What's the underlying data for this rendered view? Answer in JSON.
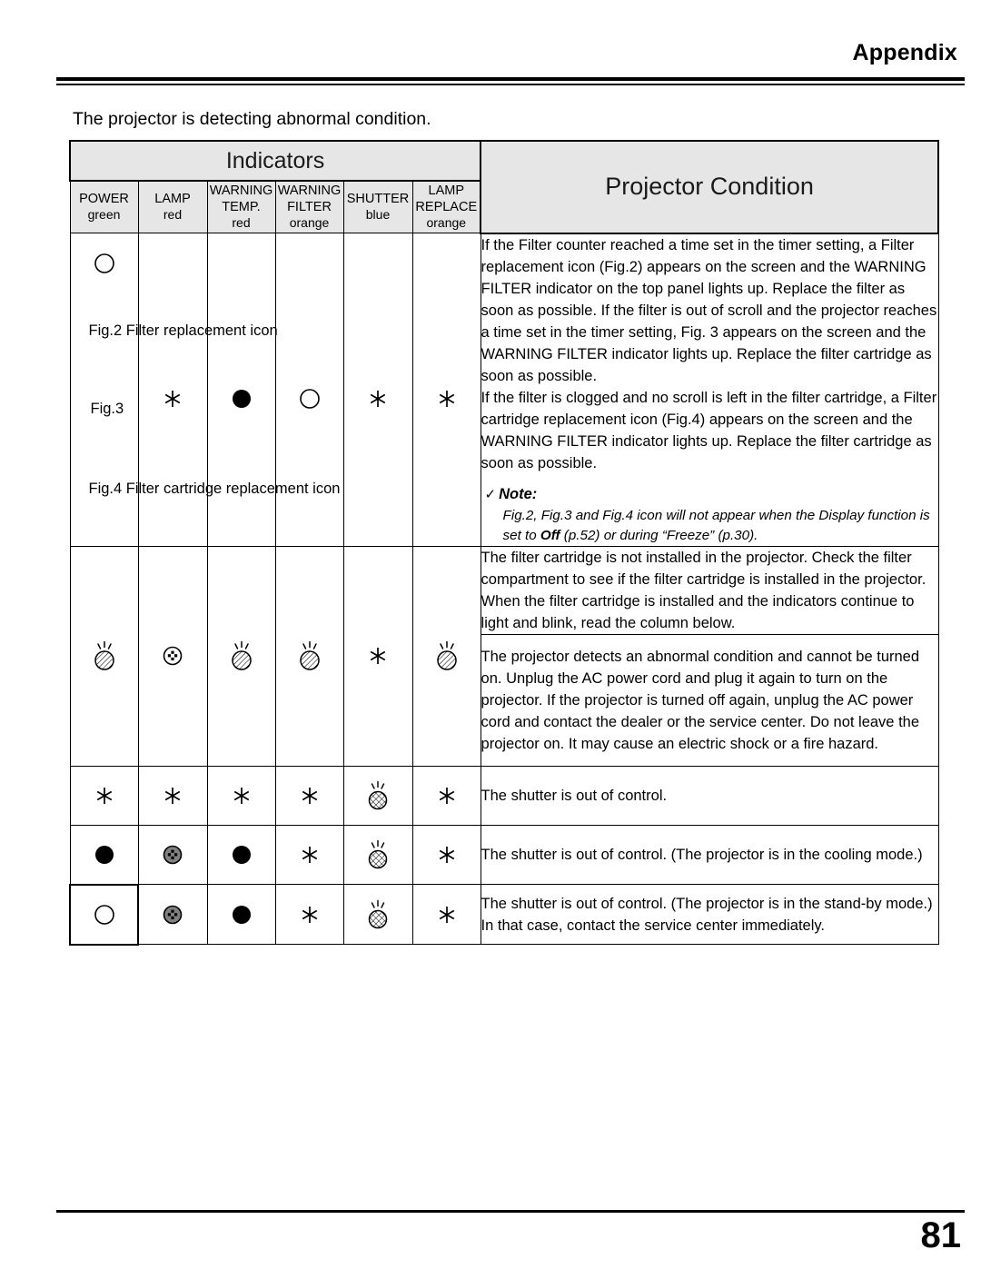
{
  "header": {
    "section_title": "Appendix"
  },
  "intro": {
    "text": "The projector is detecting abnormal condition."
  },
  "table": {
    "indicators_header": "Indicators",
    "condition_header": "Projector Condition",
    "columns": [
      {
        "name": "POWER",
        "color": "green"
      },
      {
        "name": "LAMP",
        "color": "red"
      },
      {
        "name": "WARNING TEMP.",
        "name_line1": "WARNING",
        "name_line2": "TEMP.",
        "color": "red"
      },
      {
        "name": "WARNING FILTER",
        "name_line1": "WARNING",
        "name_line2": "FILTER",
        "color": "orange"
      },
      {
        "name": "SHUTTER",
        "name_line1": "SHUTTER",
        "name_line2": "",
        "color": "blue"
      },
      {
        "name": "LAMP REPLACE",
        "name_line1": "LAMP",
        "name_line2": "REPLACE",
        "color": "orange"
      }
    ],
    "rows": [
      {
        "indicators": [
          "circle-open",
          "asterisk",
          "circle-filled",
          "circle-open",
          "asterisk",
          "asterisk"
        ],
        "figures": {
          "fig2": "Fig.2  Filter replacement icon",
          "fig3": "Fig.3",
          "fig4": "Fig.4  Filter cartridge replacement icon"
        },
        "description": [
          "If the Filter counter reached a time set in the timer setting, a Filter replacement icon (Fig.2) appears on the screen and the WARNING FILTER indicator on the top panel lights up. Replace the filter as soon as possible. If the filter is out of scroll and the projector reaches a time set in the timer setting, Fig. 3 appears on the screen and the WARNING FILTER indicator lights up. Replace the filter cartridge as soon as possible.",
          "If the filter is clogged and no scroll is left in the filter cartridge, a Filter cartridge replacement icon (Fig.4) appears on the screen and the WARNING FILTER indicator lights up. Replace the filter cartridge as soon as possible."
        ],
        "note": {
          "check": "✓",
          "title": "Note:",
          "body_part1": "Fig.2, Fig.3 and Fig.4 icon will not appear when the Display function is set to ",
          "body_bold": "Off",
          "body_part2": " (p.52) or during “Freeze” (p.30)."
        }
      },
      {
        "indicators": [
          "blink-hatch",
          "dim-dot",
          "blink-hatch",
          "blink-hatch",
          "asterisk",
          "blink-hatch"
        ],
        "description_top": "The filter cartridge is not installed in the projector. Check the filter compartment to see if the filter cartridge is installed in the projector. When the filter cartridge is installed and the indicators continue to light and blink, read the column below.",
        "description_bottom": "The projector detects an abnormal condition and cannot be turned on. Unplug the AC power cord and plug it again to turn on the projector. If the projector is turned off again, unplug the AC power cord and contact the dealer or the service center. Do not leave the projector on. It may cause an electric shock or a fire hazard."
      },
      {
        "indicators": [
          "asterisk",
          "asterisk",
          "asterisk",
          "asterisk",
          "blink-cross",
          "asterisk"
        ],
        "description": "The shutter is out of control."
      },
      {
        "indicators": [
          "circle-filled",
          "dim-dot",
          "circle-filled",
          "asterisk",
          "blink-cross",
          "asterisk"
        ],
        "description": "The shutter is out of control. (The projector is in the cooling mode.)"
      },
      {
        "indicators": [
          "circle-open",
          "dim-dot",
          "circle-filled",
          "asterisk",
          "blink-cross",
          "asterisk"
        ],
        "description": "The shutter is out of control. (The projector is in the stand-by mode.) In that case, contact the service center immediately."
      }
    ]
  },
  "footer": {
    "page_number": "81"
  },
  "colors": {
    "header_bg": "#e6e6e6",
    "rule": "#000000",
    "dim_fill": "#808080"
  }
}
